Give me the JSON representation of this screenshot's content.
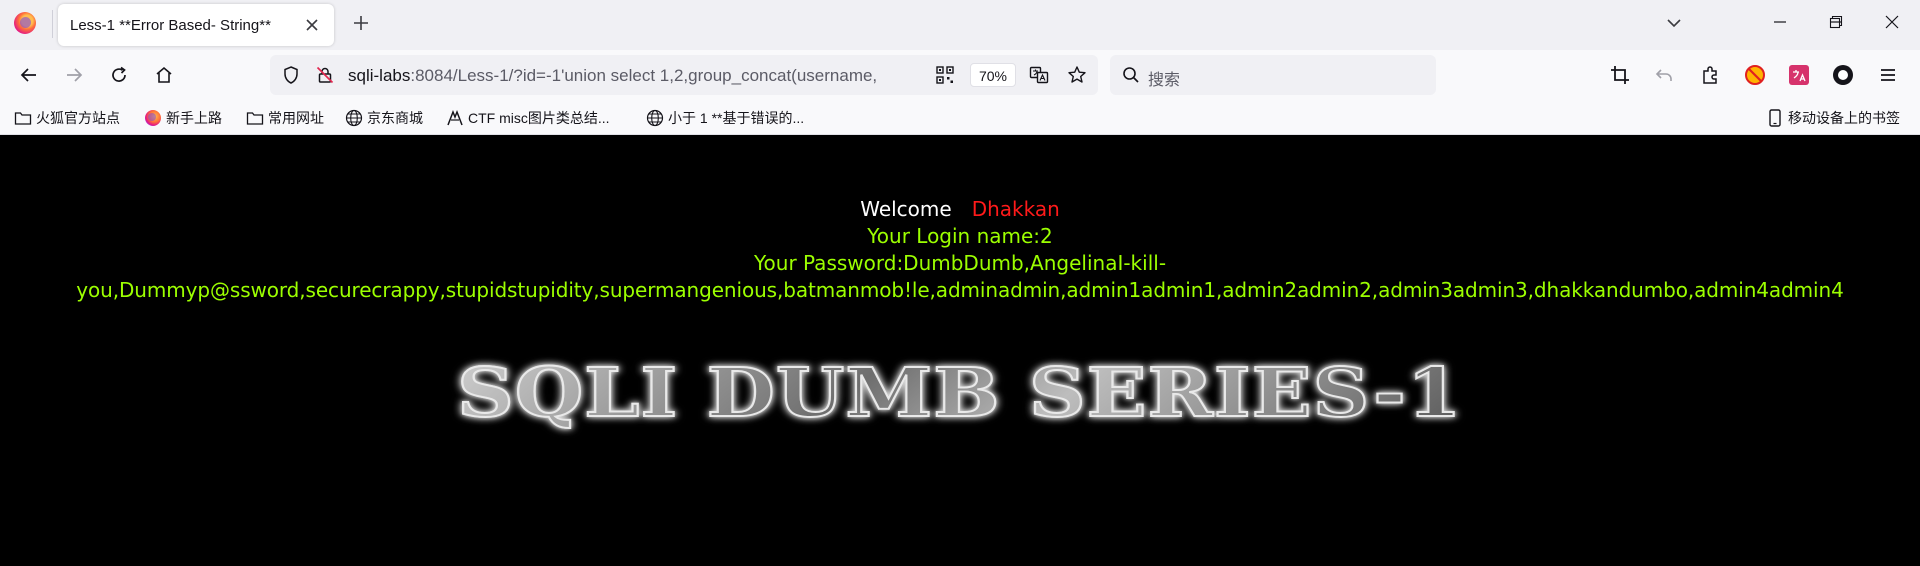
{
  "tab": {
    "title": "Less-1 **Error Based- String**"
  },
  "address_bar": {
    "host": "sqli-labs",
    "rest": ":8084/Less-1/?id=-1'union select 1,2,group_concat(username,",
    "zoom": "70%"
  },
  "search": {
    "placeholder": "搜索"
  },
  "bookmarks": [
    {
      "label": "火狐官方站点",
      "icon": "folder-icon"
    },
    {
      "label": "新手上路",
      "icon": "firefox-icon"
    },
    {
      "label": "常用网址",
      "icon": "folder-icon"
    },
    {
      "label": "京东商城",
      "icon": "globe-icon"
    },
    {
      "label": "CTF misc图片类总结...",
      "icon": "ctf-icon"
    },
    {
      "label": "小于 1 **基于错误的...",
      "icon": "globe-icon"
    }
  ],
  "mobile_bookmarks": "移动设备上的书签",
  "page": {
    "welcome_label": "Welcome",
    "welcome_name": "Dhakkan",
    "login_name": "Your Login name:2",
    "password_line1": "Your Password:DumbDumb,AngelinaI-kill-",
    "password_line2": "you,Dummyp@ssword,securecrappy,stupidstupidity,supermangenious,batmanmob!le,adminadmin,admin1admin1,admin2admin2,admin3admin3,dhakkandumbo,admin4admin4",
    "banner": "SQLI DUMB SERIES-1"
  },
  "colors": {
    "welcome": "#ffffff",
    "name": "#ff1a1a",
    "green": "#9cff00",
    "background": "#000000"
  }
}
